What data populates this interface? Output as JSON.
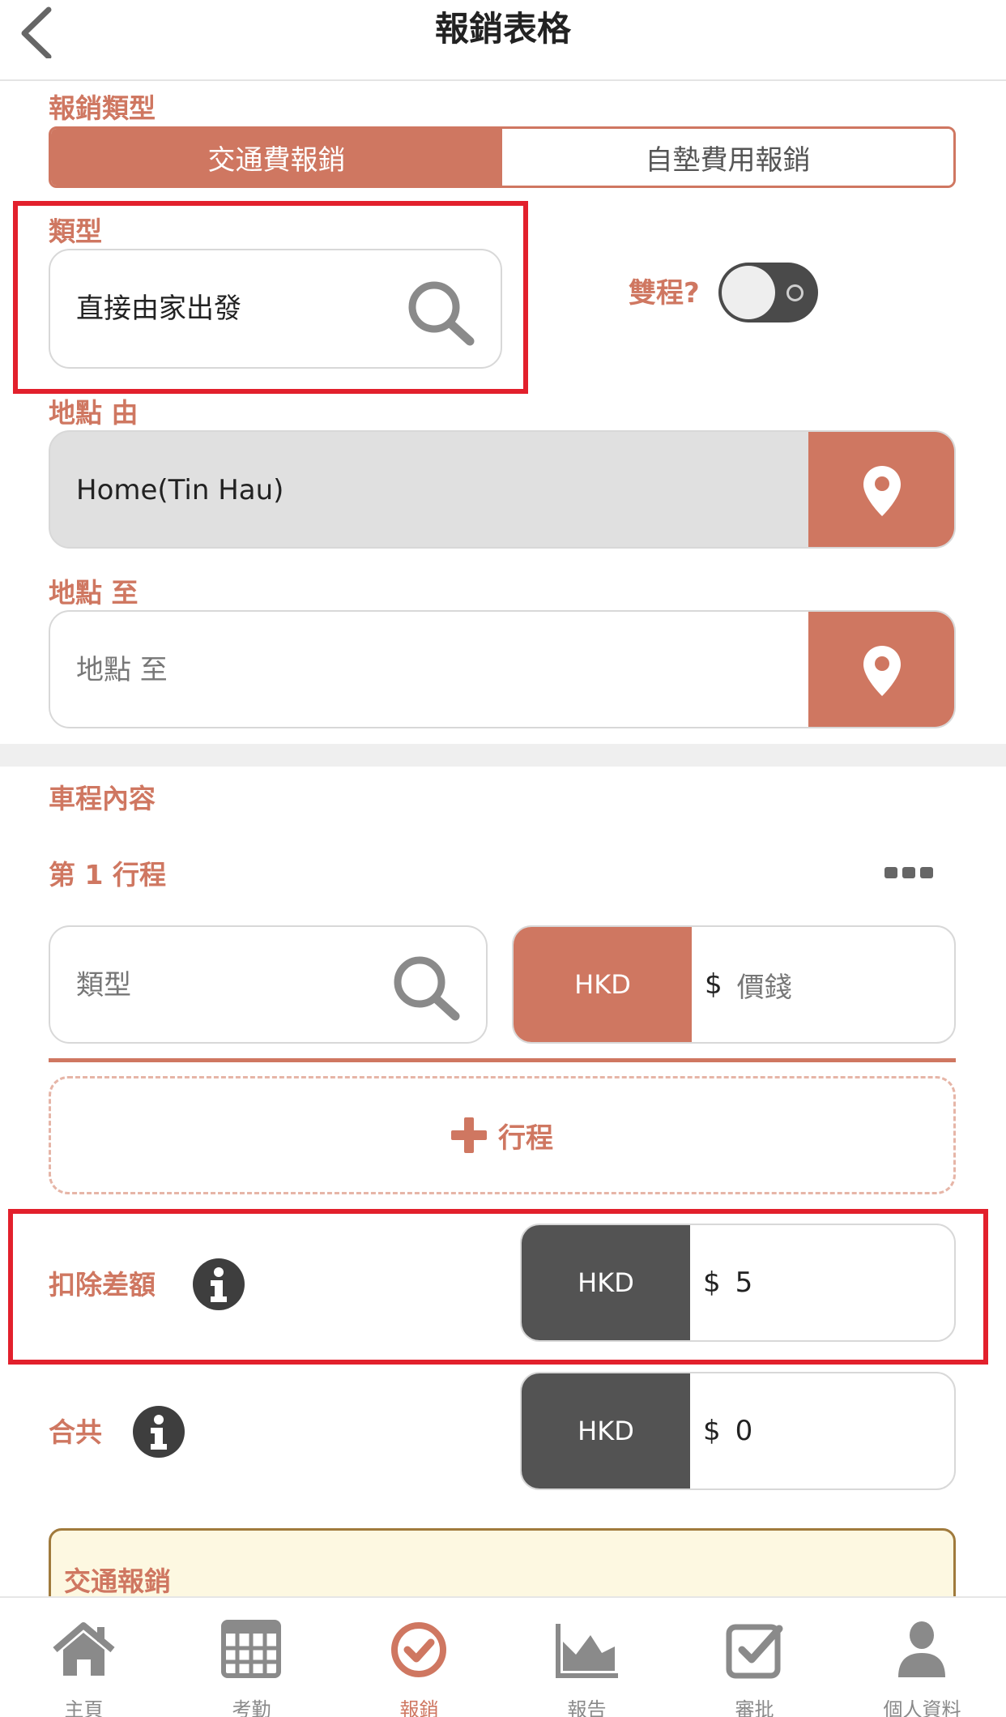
{
  "header": {
    "title": "報銷表格",
    "back_icon": "chevron-left-icon"
  },
  "form": {
    "claim_type_label": "報銷類型",
    "claim_types": [
      "交通費報銷",
      "自墊費用報銷"
    ],
    "selected_claim_type": "交通費報銷",
    "type_label": "類型",
    "type_value": "直接由家出發",
    "round_trip_label": "雙程?",
    "round_trip_enabled": false,
    "from_label": "地點 由",
    "from_value": "Home(Tin Hau)",
    "to_label": "地點 至",
    "to_placeholder": "地點 至"
  },
  "trip": {
    "section_title": "車程內容",
    "trip_title": "第 1 行程",
    "type_placeholder": "類型",
    "currency": "HKD",
    "price_symbol": "$",
    "price_placeholder": "價錢",
    "add_trip_label": "行程"
  },
  "deduction": {
    "label": "扣除差額",
    "currency": "HKD",
    "symbol": "$",
    "value": "5"
  },
  "total": {
    "label": "合共",
    "currency": "HKD",
    "symbol": "$",
    "value": "0"
  },
  "notice": {
    "title": "交通報銷"
  },
  "tabbar": {
    "items": [
      {
        "label": "主頁",
        "icon": "home-icon",
        "active": false
      },
      {
        "label": "考勤",
        "icon": "calendar-grid-icon",
        "active": false
      },
      {
        "label": "報銷",
        "icon": "check-circle-icon",
        "active": true
      },
      {
        "label": "報告",
        "icon": "area-chart-icon",
        "active": false
      },
      {
        "label": "審批",
        "icon": "checkbox-icon",
        "active": false
      },
      {
        "label": "個人資料",
        "icon": "user-icon",
        "active": false
      }
    ]
  },
  "colors": {
    "accent": "#cf7761",
    "dark": "#4a4a4a",
    "highlight": "#e2202c",
    "notice_bg": "#fdf8e1",
    "notice_border": "#a07a3c"
  }
}
